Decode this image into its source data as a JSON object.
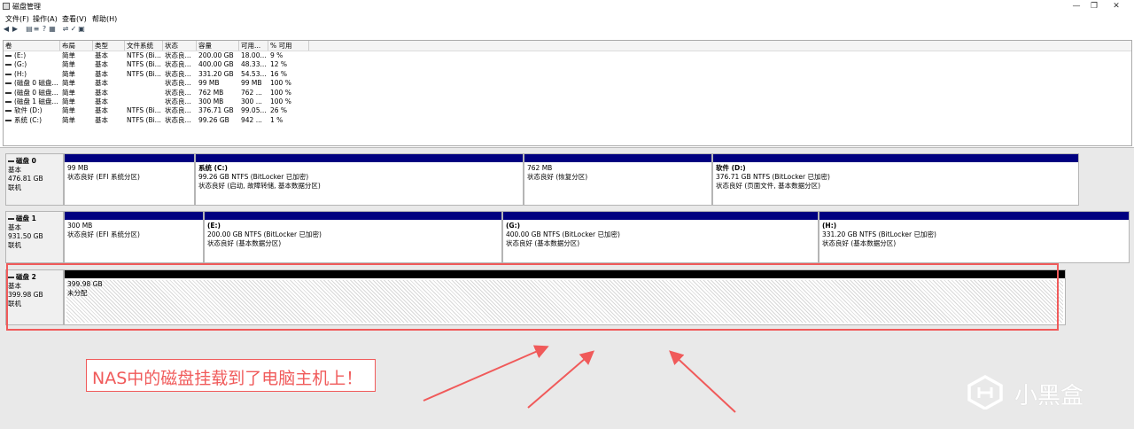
{
  "window": {
    "title": "磁盘管理",
    "minimize": "—",
    "maximize": "❐",
    "close": "✕"
  },
  "menu": [
    "文件(F)",
    "操作(A)",
    "查看(V)",
    "帮助(H)"
  ],
  "toolbar_icons": [
    "back-icon",
    "forward-icon",
    "view-icon",
    "list-icon",
    "help-icon",
    "properties-icon",
    "connect-icon",
    "check-icon",
    "grid-icon"
  ],
  "table": {
    "headers": [
      "卷",
      "布局",
      "类型",
      "文件系统",
      "状态",
      "容量",
      "可用...",
      "% 可用"
    ],
    "rows": [
      [
        "(E:)",
        "简单",
        "基本",
        "NTFS (Bi...",
        "状态良...",
        "200.00 GB",
        "18.00...",
        "9 %"
      ],
      [
        "(G:)",
        "简单",
        "基本",
        "NTFS (Bi...",
        "状态良...",
        "400.00 GB",
        "48.33...",
        "12 %"
      ],
      [
        "(H:)",
        "简单",
        "基本",
        "NTFS (Bi...",
        "状态良...",
        "331.20 GB",
        "54.53...",
        "16 %"
      ],
      [
        "(磁盘 0 磁盘...",
        "简单",
        "基本",
        "",
        "状态良...",
        "99 MB",
        "99 MB",
        "100 %"
      ],
      [
        "(磁盘 0 磁盘...",
        "简单",
        "基本",
        "",
        "状态良...",
        "762 MB",
        "762 ...",
        "100 %"
      ],
      [
        "(磁盘 1 磁盘...",
        "简单",
        "基本",
        "",
        "状态良...",
        "300 MB",
        "300 ...",
        "100 %"
      ],
      [
        "软件 (D:)",
        "简单",
        "基本",
        "NTFS (Bi...",
        "状态良...",
        "376.71 GB",
        "99.05...",
        "26 %"
      ],
      [
        "系统 (C:)",
        "简单",
        "基本",
        "NTFS (Bi...",
        "状态良...",
        "99.26 GB",
        "942 ...",
        "1 %"
      ]
    ]
  },
  "disks": [
    {
      "name": "磁盘 0",
      "type": "基本",
      "size": "476.81 GB",
      "status": "联机",
      "partitions": [
        {
          "name": "",
          "size": "99 MB",
          "status": "状态良好 (EFI 系统分区)"
        },
        {
          "name": "系统  (C:)",
          "size": "99.26 GB NTFS (BitLocker 已加密)",
          "status": "状态良好 (启动, 故障转储, 基本数据分区)"
        },
        {
          "name": "",
          "size": "762 MB",
          "status": "状态良好 (恢复分区)"
        },
        {
          "name": "软件  (D:)",
          "size": "376.71 GB NTFS (BitLocker 已加密)",
          "status": "状态良好 (页面文件, 基本数据分区)"
        }
      ]
    },
    {
      "name": "磁盘 1",
      "type": "基本",
      "size": "931.50 GB",
      "status": "联机",
      "partitions": [
        {
          "name": "",
          "size": "300 MB",
          "status": "状态良好 (EFI 系统分区)"
        },
        {
          "name": "(E:)",
          "size": "200.00 GB NTFS (BitLocker 已加密)",
          "status": "状态良好 (基本数据分区)"
        },
        {
          "name": "(G:)",
          "size": "400.00 GB NTFS (BitLocker 已加密)",
          "status": "状态良好 (基本数据分区)"
        },
        {
          "name": "(H:)",
          "size": "331.20 GB NTFS (BitLocker 已加密)",
          "status": "状态良好 (基本数据分区)"
        }
      ]
    },
    {
      "name": "磁盘 2",
      "type": "基本",
      "size": "399.98 GB",
      "status": "联机",
      "partitions": [
        {
          "name": "",
          "size": "399.98 GB",
          "status": "未分配"
        }
      ]
    }
  ],
  "annotation": {
    "text": "NAS中的磁盘挂载到了电脑主机上！",
    "color": "#f05a5a"
  },
  "watermark": {
    "text": "小黑盒"
  },
  "colors": {
    "primary_bar": "#000080",
    "unallocated_bar": "#000000",
    "annotation": "#f05a5a"
  }
}
